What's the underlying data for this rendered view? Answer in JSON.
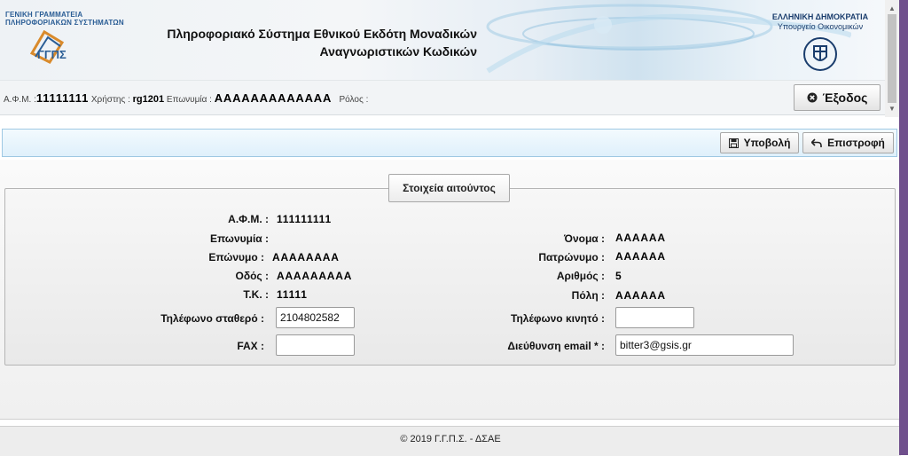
{
  "header": {
    "org_line1": "ΓΕΝΙΚΗ ΓΡΑΜΜΑΤΕΙΑ",
    "org_line2": "ΠΛΗΡΟΦΟΡΙΑΚΩΝ ΣΥΣΤΗΜΑΤΩΝ",
    "app_title_line1": "Πληροφοριακό Σύστημα Εθνικού Εκδότη Μοναδικών",
    "app_title_line2": "Αναγνωριστικών Κωδικών",
    "gov_line1": "ΕΛΛΗΝΙΚΗ ΔΗΜΟΚΡΑΤΙΑ",
    "gov_line2": "Υπουργείο Οικονομικών"
  },
  "userbar": {
    "afm_label": "Α.Φ.Μ. :",
    "afm_value": "11111111",
    "user_label": "Χρήστης :",
    "user_value": "rg1201",
    "name_label": "Επωνυμία :",
    "name_value": "ΑΑΑΑΑΑΑΑΑΑΑΑΑ",
    "role_label": "Ρόλος :",
    "logout_label": "Έξοδος",
    "logout_icon": "close-circle-icon"
  },
  "toolbar": {
    "submit_label": "Υποβολή",
    "submit_icon": "save-icon",
    "back_label": "Επιστροφή",
    "back_icon": "undo-arrow-icon"
  },
  "form": {
    "legend": "Στοιχεία αιτούντος",
    "afm_label": "Α.Φ.Μ. :",
    "afm_value": "111111111",
    "eponymia_label": "Επωνυμία :",
    "eponymo_label": "Επώνυμο :",
    "eponymo_value": "ΑΑΑΑΑΑΑΑ",
    "odos_label": "Οδός :",
    "odos_value": "ΑΑΑΑΑΑΑΑΑ",
    "tk_label": "Τ.Κ. :",
    "tk_value": "11111",
    "phone_label": "Τηλέφωνο σταθερό :",
    "phone_value": "2104802582",
    "fax_label": "FAX :",
    "fax_value": "",
    "onoma_label": "Όνομα :",
    "onoma_value": "ΑΑΑΑΑΑ",
    "patronymo_label": "Πατρώνυμο :",
    "patronymo_value": "ΑΑΑΑΑΑ",
    "arithmos_label": "Αριθμός :",
    "arithmos_value": "5",
    "poli_label": "Πόλη :",
    "poli_value": "ΑΑΑΑΑΑ",
    "mobile_label": "Τηλέφωνο κινητό :",
    "mobile_value": "",
    "email_label": "Διεύθυνση email * :",
    "email_value": "bitter3@gsis.gr"
  },
  "footer": {
    "text": "© 2019 Γ.Γ.Π.Σ. - ΔΣΑΕ"
  },
  "colors": {
    "accent_blue": "#2a5d95",
    "toolbar_border": "#9ec8e3",
    "scroll_purple": "#6f4f8c"
  }
}
